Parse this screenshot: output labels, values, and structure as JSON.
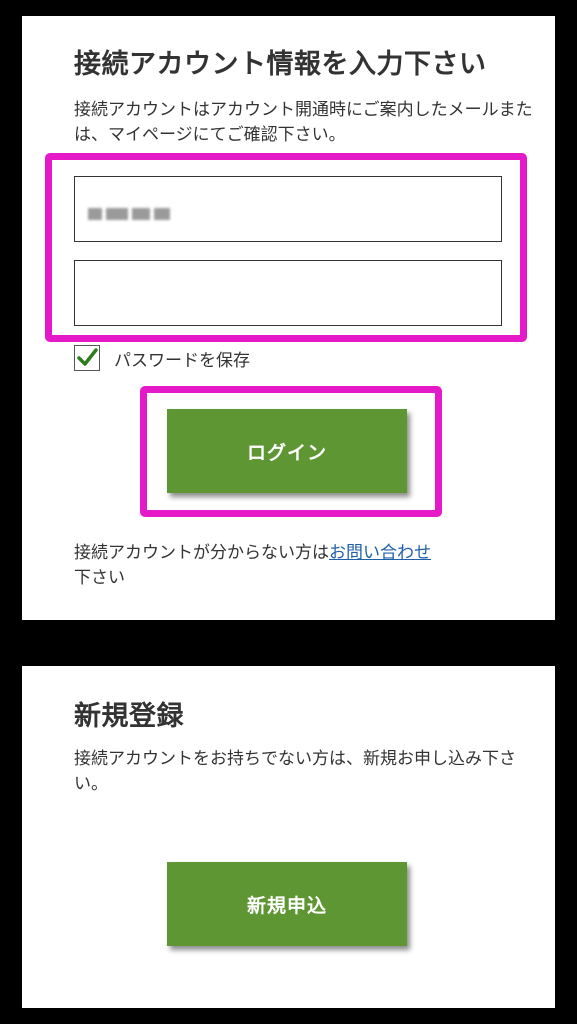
{
  "login": {
    "title": "接続アカウント情報を入力下さい",
    "description": "接続アカウントはアカウント開通時にご案内したメールまたは、マイページにてご確認下さい。",
    "account_field": {
      "value": "",
      "placeholder": ""
    },
    "password_field": {
      "value": "",
      "placeholder": ""
    },
    "remember_password": {
      "label": "パスワードを保存",
      "checked": true
    },
    "login_button": "ログイン",
    "help_text_before": "接続アカウントが分からない方は",
    "help_link": "お問い合わせ",
    "help_text_after": "下さい"
  },
  "register": {
    "title": "新規登録",
    "description": "接続アカウントをお持ちでない方は、新規お申し込み下さい。",
    "button": "新規申込"
  },
  "colors": {
    "background": "#000000",
    "card": "#ffffff",
    "highlight": "#e619c8",
    "button": "#5e9634",
    "link": "#1f5fa8",
    "checkmark": "#2e7d1f"
  }
}
